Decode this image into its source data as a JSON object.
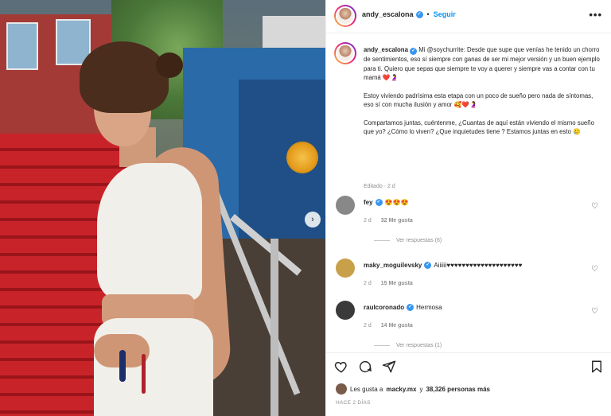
{
  "post": {
    "author": "andy_escalona",
    "follow_label": "Seguir",
    "more_label": "•••",
    "carousel_next": "›"
  },
  "caption": {
    "author": "andy_escalona",
    "paragraphs": [
      "Mi @soychurrite: Desde que supe que venías he tenido un chorro de sentimientos, eso sí siempre con ganas de ser mi mejor versión y un buen ejemplo para ti. Quiero que sepas que siempre te voy a querer y siempre vas a contar con tu mamá ❤️🤰",
      "Estoy viviendo padrísima esta etapa con un poco de sueño pero nada de síntomas, eso sí con mucha ilusión y amor 🥰❤️🤰",
      "Compartamos juntas, cuéntenme, ¿Cuantas de aquí están viviendo el mismo sueño que yo? ¿Cómo lo viven? ¿Que inquietudes tiene ? Estamos juntas en esto 🥲"
    ],
    "meta": "Editado · 2 d"
  },
  "comments": [
    {
      "user": "fey",
      "text": "😍😍😍",
      "age": "2 d",
      "likes": "32 Me gusta",
      "replies": "Ver respuestas (6)",
      "avatar_color": "#9a9a9a"
    },
    {
      "user": "maky_moguilevsky",
      "text": "Aiiiiii♥♥♥♥♥♥♥♥♥♥♥♥♥♥♥♥♥♥♥♥",
      "age": "2 d",
      "likes": "15 Me gusta",
      "replies": "",
      "avatar_color": "#c9a04a"
    },
    {
      "user": "raulcoronado",
      "text": "Hermosa",
      "age": "2 d",
      "likes": "14 Me gusta",
      "replies": "Ver respuestas (1)",
      "avatar_color": "#3a3a3a"
    }
  ],
  "footer": {
    "likes_prefix": "Les gusta a",
    "likes_user": "macky.mx",
    "likes_middle": "y",
    "likes_count": "38,326 personas más",
    "date": "HACE 2 DÍAS"
  },
  "icons": {
    "heart": "heart-icon",
    "comment": "comment-icon",
    "share": "share-icon",
    "save": "bookmark-icon"
  },
  "colors": {
    "accent": "#0095f6",
    "verified": "#3897f0",
    "muted": "#8e8e8e"
  }
}
